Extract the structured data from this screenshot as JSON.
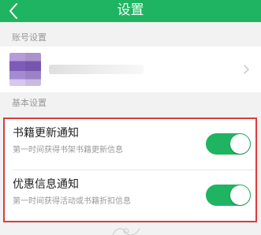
{
  "header": {
    "title": "设置",
    "back_icon": "chevron-left-icon",
    "background": "#1fb461"
  },
  "sections": {
    "account_label": "账号设置",
    "basic_label": "基本设置"
  },
  "account": {
    "avatar_icon": "avatar",
    "chevron_icon": "chevron-right-icon"
  },
  "settings": [
    {
      "title": "书籍更新通知",
      "description": "第一时间获得书架书籍更新信息",
      "enabled": true
    },
    {
      "title": "优惠信息通知",
      "description": "第一时间获得活动或书籍折扣信息",
      "enabled": true
    }
  ],
  "colors": {
    "accent": "#1fb461",
    "highlight_border": "#e03a3a"
  }
}
